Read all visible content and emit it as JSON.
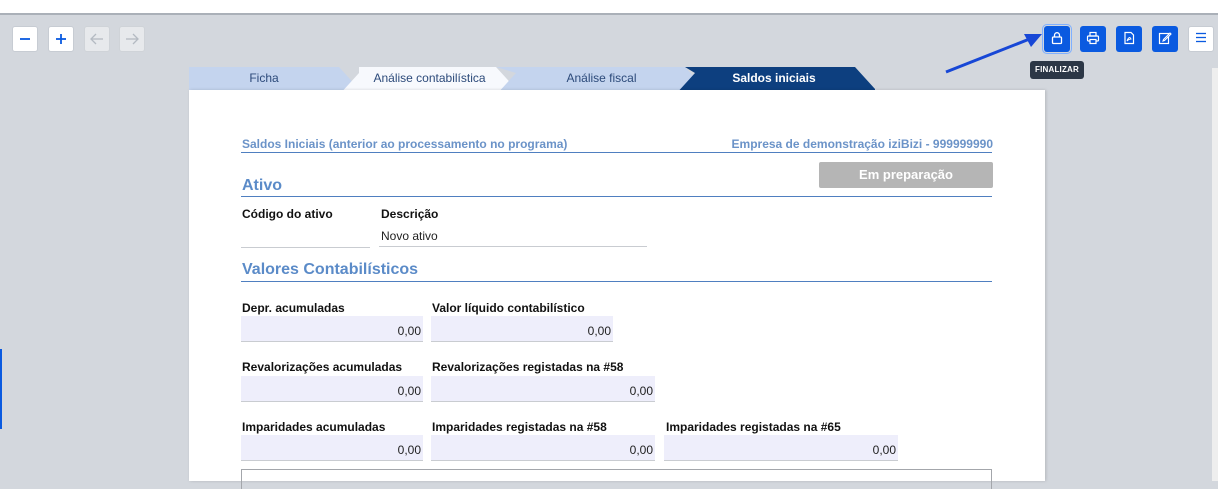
{
  "toolbar_left": {
    "zoom_out": "−",
    "zoom_in": "+",
    "back": "←",
    "forward": "→"
  },
  "toolbar_right": {
    "buttons": [
      "lock-icon",
      "printer-icon",
      "pdf-icon",
      "edit-icon"
    ],
    "menu": "hamburger-icon",
    "tooltip": "FINALIZAR"
  },
  "tabs": [
    "Ficha",
    "Análise contabilística",
    "Análise fiscal",
    "Saldos iniciais"
  ],
  "header": {
    "left": "Saldos Iniciais (anterior ao processamento no programa)",
    "right": "Empresa de demonstração iziBizi - 999999990"
  },
  "status_button": "Em preparação",
  "ativo": {
    "title": "Ativo",
    "codigo_label": "Código do ativo",
    "codigo_value": "",
    "descricao_label": "Descrição",
    "descricao_value": "Novo ativo"
  },
  "valores": {
    "title": "Valores Contabilísticos",
    "fields": [
      {
        "label": "Depr. acumuladas",
        "value": "0,00"
      },
      {
        "label": "Valor líquido contabilístico",
        "value": "0,00"
      },
      {
        "label": "Revalorizações acumuladas",
        "value": "0,00"
      },
      {
        "label": "Revalorizações registadas na #58",
        "value": "0,00"
      },
      {
        "label": "Imparidades acumuladas",
        "value": "0,00"
      },
      {
        "label": "Imparidades registadas na #58",
        "value": "0,00"
      },
      {
        "label": "Imparidades registadas na #65",
        "value": "0,00"
      }
    ]
  },
  "colors": {
    "accent": "#0a5ae0",
    "tab_active": "#0d3f7f",
    "tab_inactive": "#c4d4ee",
    "section_title": "#5b8bc8",
    "field_bg": "#eeeefb"
  }
}
